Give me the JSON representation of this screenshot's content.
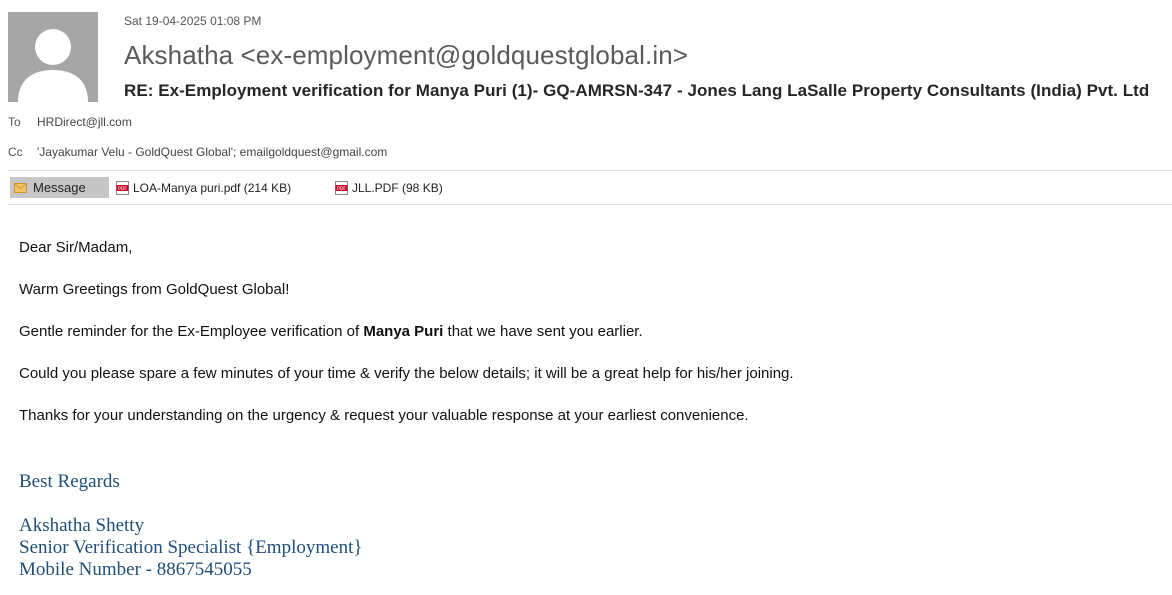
{
  "header": {
    "date": "Sat 19-04-2025 01:08 PM",
    "sender": "Akshatha <ex-employment@goldquestglobal.in>",
    "subject": "RE: Ex-Employment verification for Manya Puri (1)- GQ-AMRSN-347 - Jones Lang LaSalle Property Consultants (India) Pvt. Ltd",
    "to_label": "To",
    "to_value": "HRDirect@jll.com",
    "cc_label": "Cc",
    "cc_value": "'Jayakumar Velu - GoldQuest Global'; emailgoldquest@gmail.com"
  },
  "attachments_bar": {
    "message_tab": "Message",
    "attachments": [
      {
        "name": "LOA-Manya puri.pdf (214 KB)",
        "icon": "pdf-icon"
      },
      {
        "name": "JLL.PDF (98 KB)",
        "icon": "pdf-icon"
      }
    ]
  },
  "body": {
    "greeting": "Dear Sir/Madam,",
    "line1": "Warm Greetings from GoldQuest Global!",
    "line2_prefix": "Gentle reminder for the Ex-Employee verification of ",
    "line2_bold": "Manya Puri",
    "line2_suffix": " that we have sent you earlier.",
    "line3": "Could you please spare a few minutes of your time & verify the below details; it will be a great help for his/her joining.",
    "line4": "Thanks for your understanding on the urgency & request your valuable response at your earliest convenience."
  },
  "signature": {
    "regards": "Best Regards",
    "name": "Akshatha Shetty",
    "title": "Senior Verification Specialist {Employment}",
    "mobile": "Mobile Number - 8867545055"
  },
  "colors": {
    "signature": "#1f4e79",
    "avatar_bg": "#a6a6a6",
    "message_tab_bg": "#c6c6c6",
    "pdf_red": "#c8102e"
  }
}
